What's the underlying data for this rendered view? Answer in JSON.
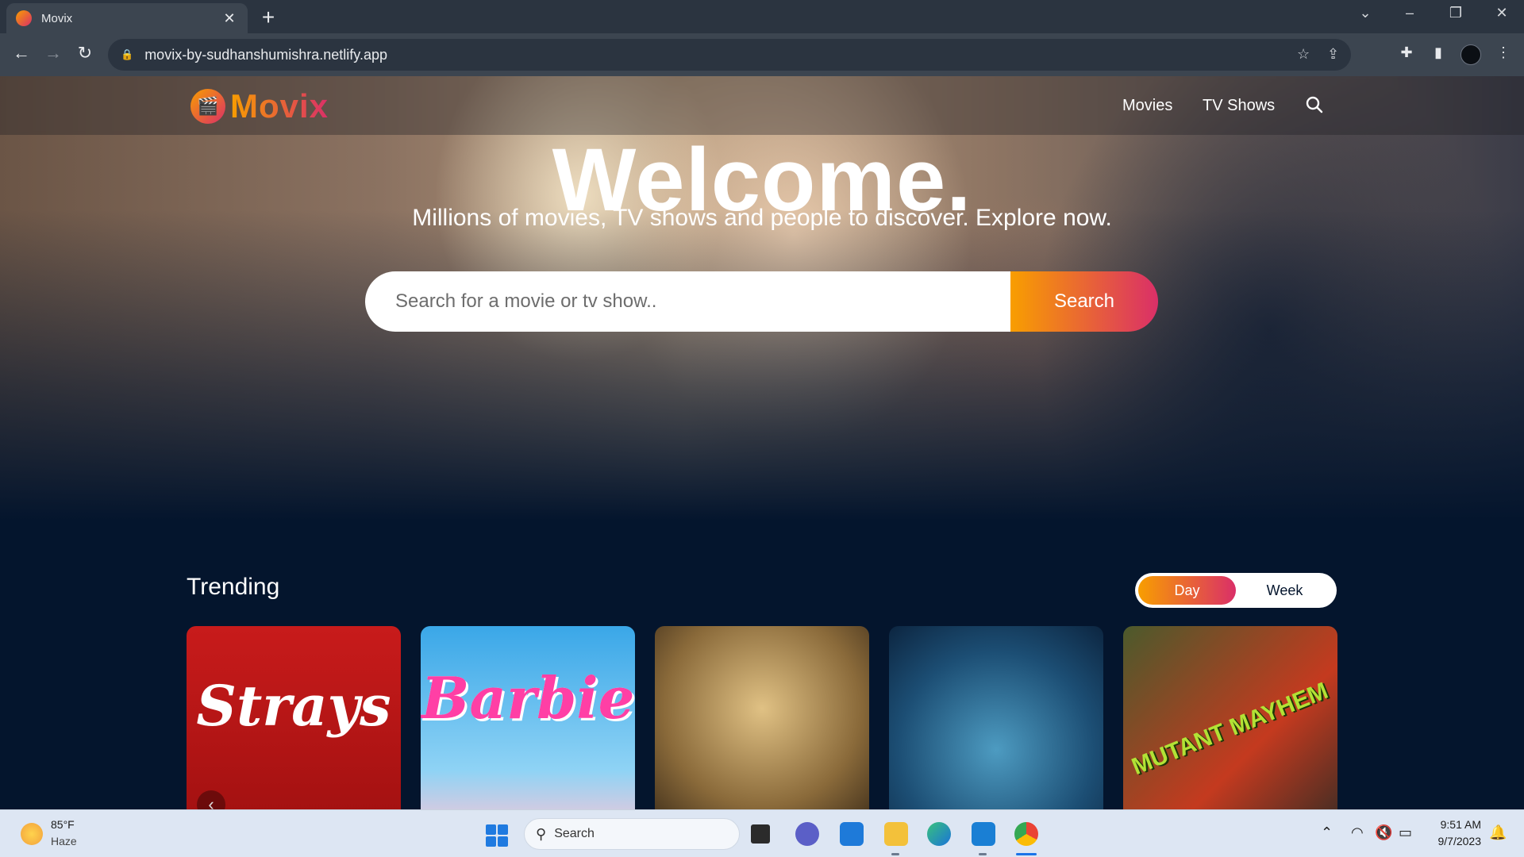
{
  "browser": {
    "tab_title": "Movix",
    "url": "movix-by-sudhanshumishra.netlify.app",
    "new_tab_icon": "plus-icon",
    "controls": [
      "chevron-down-icon",
      "minimize-icon",
      "restore-icon",
      "close-icon"
    ]
  },
  "site": {
    "logo_text": "Movix",
    "nav": {
      "movies": "Movies",
      "tv_shows": "TV Shows"
    }
  },
  "hero": {
    "title": "Welcome.",
    "subtitle": "Millions of movies, TV shows and people to discover. Explore now.",
    "search_placeholder": "Search for a movie or tv show..",
    "search_button": "Search"
  },
  "trending": {
    "title": "Trending",
    "switch": {
      "day": "Day",
      "week": "Week",
      "active": "Day"
    },
    "cards": [
      {
        "title": "Strays"
      },
      {
        "title": "Barbie"
      },
      {
        "title": ""
      },
      {
        "title": ""
      },
      {
        "title": "MUTANT MAYHEM"
      }
    ]
  },
  "taskbar": {
    "weather_temp": "85°F",
    "weather_cond": "Haze",
    "search_label": "Search",
    "time": "9:51 AM",
    "date": "9/7/2023"
  },
  "colors": {
    "accent_start": "#f89e00",
    "accent_end": "#da2f68",
    "page_bg": "#04152d"
  }
}
